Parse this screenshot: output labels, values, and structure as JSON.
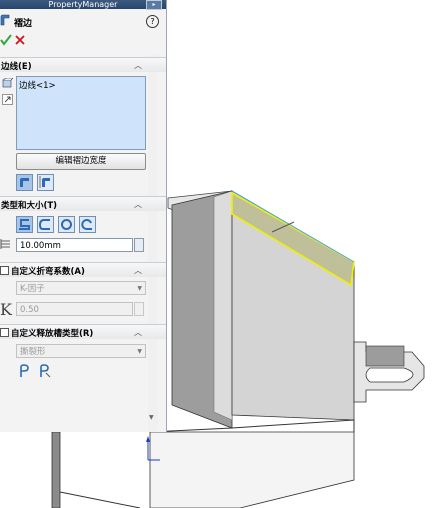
{
  "header": {
    "title": "PropertyManager"
  },
  "feature": {
    "title": "褶边",
    "icon": "hem-feature-icon",
    "help_label": "?"
  },
  "actions": {
    "ok_label": "✓",
    "cancel_label": "✕"
  },
  "edges_group": {
    "title": "边线(E)",
    "items": [
      "边线<1>"
    ],
    "edit_width_button": "编辑褶边宽度"
  },
  "type_group": {
    "title": "类型和大小(T)",
    "length_value": "10.00mm"
  },
  "k_factor_group": {
    "title": "自定义折弯系数(A)",
    "dropdown_value": "K-因子",
    "k_letter": "K",
    "k_value": "0.50"
  },
  "relief_group": {
    "title": "自定义释放槽类型(R)",
    "dropdown_value": "撕裂形"
  },
  "colors": {
    "accent_ok": "#2fa83c",
    "accent_cancel": "#d1141b",
    "selection_highlight": "#f0f000",
    "list_bg": "#cfe4fb"
  }
}
